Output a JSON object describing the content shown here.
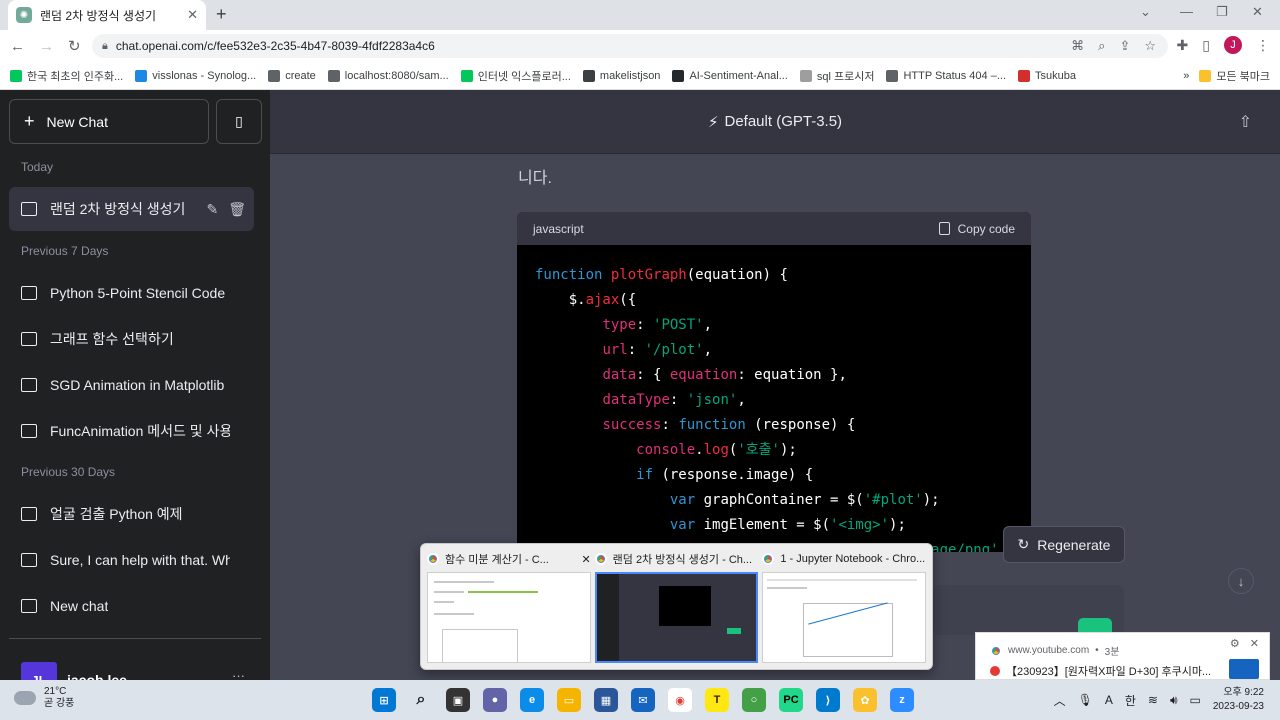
{
  "browser": {
    "tab_title": "랜덤 2차 방정식 생성기",
    "url": "chat.openai.com/c/fee532e3-2c35-4b47-8039-4fdf2283a4c6",
    "bookmarks": [
      {
        "label": "한국 최초의 인주화...",
        "color": "#03c75a"
      },
      {
        "label": "visslonas - Synolog...",
        "color": "#1e88e5"
      },
      {
        "label": "create",
        "color": "#5f6368"
      },
      {
        "label": "localhost:8080/sam...",
        "color": "#5f6368"
      },
      {
        "label": "인터넷 익스플로러...",
        "color": "#03c75a"
      },
      {
        "label": "makelistjson",
        "color": "#3c4043"
      },
      {
        "label": "AI-Sentiment-Anal...",
        "color": "#24292e"
      },
      {
        "label": "sql 프로시저",
        "color": "#9e9e9e"
      },
      {
        "label": "HTTP Status 404 –...",
        "color": "#5f6368"
      },
      {
        "label": "Tsukuba",
        "color": "#d32f2f"
      }
    ],
    "bookmarks_folder": "모든 북마크",
    "profile_initial": "J"
  },
  "sidebar": {
    "new_chat_label": "New Chat",
    "sections": [
      {
        "title": "Today",
        "items": [
          "랜덤 2차 방정식 생성기"
        ]
      },
      {
        "title": "Previous 7 Days",
        "items": [
          "Python 5-Point Stencil Code",
          "그래프 함수 선택하기",
          "SGD Animation in Matplotlib",
          "FuncAnimation 메서드 및 사용"
        ]
      },
      {
        "title": "Previous 30 Days",
        "items": [
          "얼굴 검출 Python 예제",
          "Sure, I can help with that. What",
          "New chat"
        ]
      }
    ],
    "user_name": "jacob lee",
    "user_initial": "JL"
  },
  "main": {
    "model_label": "Default (GPT-3.5)",
    "message_tail": "니다.",
    "code_language": "javascript",
    "copy_label": "Copy code",
    "regenerate_label": "Regenerate"
  },
  "thumbnails": [
    {
      "title": "함수 미분 계산기 - C..."
    },
    {
      "title": "랜덤 2차 방정식 생성기 - Ch..."
    },
    {
      "title": "1 - Jupyter Notebook - Chro..."
    }
  ],
  "notification": {
    "source": "www.youtube.com",
    "age": "3분",
    "text": "【230923】[원자력X파일 D+30] 후쿠시마..."
  },
  "taskbar": {
    "temperature": "21°C",
    "weather": "곧 강풍",
    "ime": "한",
    "time": "오후 9:22",
    "date": "2023-09-23"
  }
}
